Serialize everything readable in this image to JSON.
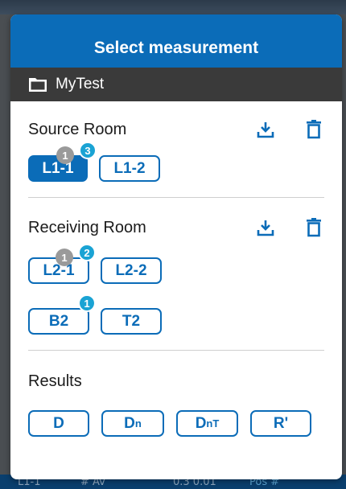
{
  "dialog": {
    "title": "Select measurement",
    "folder": "MyTest"
  },
  "source_room": {
    "title": "Source Room",
    "chips": [
      {
        "label": "L1-1",
        "selected": true,
        "badge_gray": "1",
        "badge_teal": "3"
      },
      {
        "label": "L1-2",
        "selected": false
      }
    ]
  },
  "receiving_room": {
    "title": "Receiving Room",
    "chips": [
      {
        "label": "L2-1",
        "selected": false,
        "badge_gray": "1",
        "badge_teal": "2"
      },
      {
        "label": "L2-2",
        "selected": false
      },
      {
        "label": "B2",
        "selected": false,
        "badge_teal": "1"
      },
      {
        "label": "T2",
        "selected": false
      }
    ]
  },
  "results": {
    "title": "Results",
    "buttons": [
      {
        "main": "D",
        "sub": ""
      },
      {
        "main": "D",
        "sub": "n"
      },
      {
        "main": "D",
        "sub": "nT"
      },
      {
        "main": "R'",
        "sub": ""
      }
    ]
  },
  "background": {
    "bottom_texts": [
      "L1-1",
      "# Av",
      "0.3 0.01",
      "Pos #"
    ]
  },
  "colors": {
    "accent": "#0b6cb8",
    "badge_teal": "#1aa3d4",
    "badge_gray": "#9a9a9a",
    "folder_bar": "#3a3a3a"
  },
  "icons": {
    "folder": "folder-icon",
    "download": "download-icon",
    "delete": "trash-icon"
  }
}
